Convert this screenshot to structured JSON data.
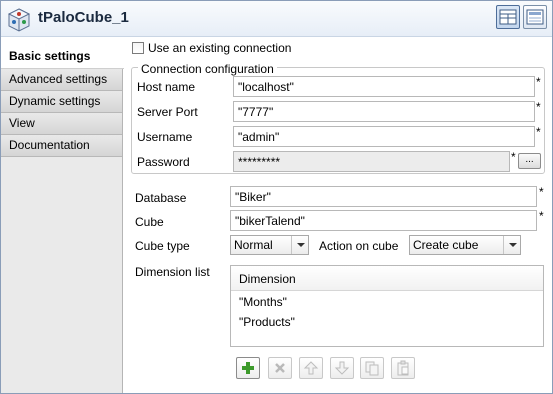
{
  "component": {
    "title": "tPaloCube_1",
    "icon": "palo-cube-icon"
  },
  "toolbar_buttons": [
    "grid-view-icon",
    "compact-view-icon"
  ],
  "tabs": [
    {
      "label": "Basic settings",
      "active": true
    },
    {
      "label": "Advanced settings",
      "active": false
    },
    {
      "label": "Dynamic settings",
      "active": false
    },
    {
      "label": "View",
      "active": false
    },
    {
      "label": "Documentation",
      "active": false
    }
  ],
  "use_existing_connection": {
    "label": "Use an existing connection",
    "checked": false
  },
  "connection": {
    "group_label": "Connection configuration",
    "host_label": "Host name",
    "host_value": "\"localhost\"",
    "port_label": "Server Port",
    "port_value": "\"7777\"",
    "username_label": "Username",
    "username_value": "\"admin\"",
    "password_label": "Password",
    "password_value": "*********",
    "browse_label": "...",
    "required_mark": "*"
  },
  "database": {
    "label": "Database",
    "value": "\"Biker\""
  },
  "cube": {
    "label": "Cube",
    "value": "\"bikerTalend\""
  },
  "cube_type": {
    "label": "Cube type",
    "selected": "Normal"
  },
  "action_on_cube": {
    "label": "Action on cube",
    "selected": "Create cube"
  },
  "dimension_list": {
    "label": "Dimension list",
    "column_header": "Dimension",
    "rows": [
      "\"Months\"",
      "\"Products\""
    ]
  },
  "table_tools": [
    {
      "icon": "add-icon",
      "enabled": true
    },
    {
      "icon": "remove-icon",
      "enabled": false
    },
    {
      "icon": "move-up-icon",
      "enabled": false
    },
    {
      "icon": "move-down-icon",
      "enabled": false
    },
    {
      "icon": "copy-icon",
      "enabled": false
    },
    {
      "icon": "paste-icon",
      "enabled": false
    }
  ],
  "colors": {
    "accent_green": "#3d9a2b",
    "title_text": "#1b2a3f"
  }
}
